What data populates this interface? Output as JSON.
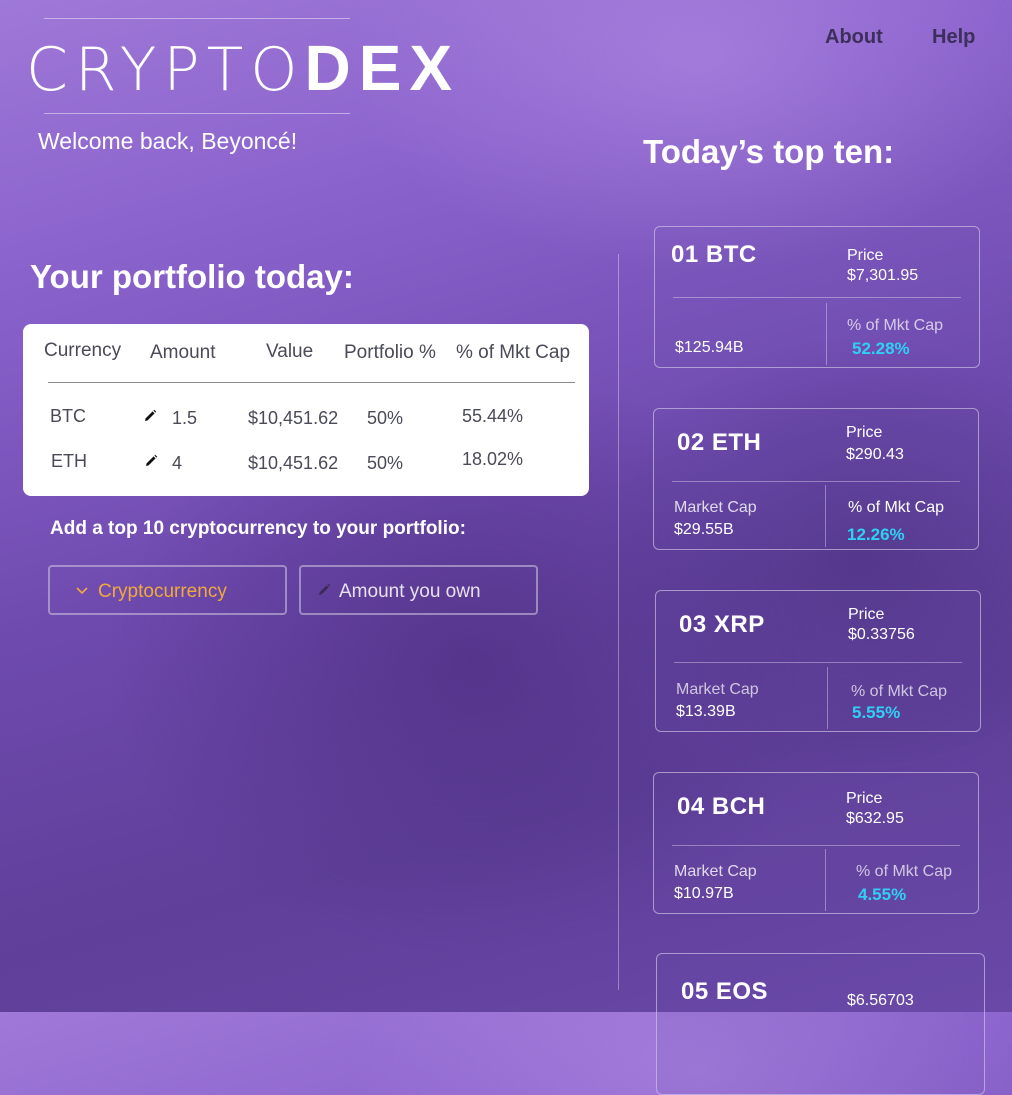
{
  "app": {
    "logo_light": "CRYPTO",
    "logo_bold": "DEX",
    "welcome": "Welcome back, Beyoncé!"
  },
  "nav": {
    "about": "About",
    "help": "Help"
  },
  "portfolio": {
    "heading": "Your portfolio today:",
    "columns": [
      "Currency",
      "Amount",
      "Value",
      "Portfolio %",
      "% of Mkt Cap"
    ],
    "rows": [
      {
        "currency": "BTC",
        "amount": "1.5",
        "value": "$10,451.62",
        "portfolio_pct": "50%",
        "mkt_cap_pct": "55.44%"
      },
      {
        "currency": "ETH",
        "amount": "4",
        "value": "$10,451.62",
        "portfolio_pct": "50%",
        "mkt_cap_pct": "18.02%"
      }
    ]
  },
  "add_form": {
    "label": "Add a top 10 cryptocurrency to your portfolio:",
    "select_placeholder": "Cryptocurrency",
    "amount_placeholder": "Amount you own"
  },
  "top_ten": {
    "heading": "Today’s top ten:",
    "coins": [
      {
        "title": "01 BTC",
        "price_label": "Price",
        "price": "$7,301.95",
        "mc_label": "",
        "market_cap": "$125.94B",
        "pct_label": "% of Mkt Cap",
        "pct": "52.28%"
      },
      {
        "title": "02 ETH",
        "price_label": "Price",
        "price": "$290.43",
        "mc_label": "Market Cap",
        "market_cap": "$29.55B",
        "pct_label": "% of Mkt Cap",
        "pct": "12.26%"
      },
      {
        "title": "03 XRP",
        "price_label": "Price",
        "price": "$0.33756",
        "mc_label": "Market Cap",
        "market_cap": "$13.39B",
        "pct_label": "% of Mkt Cap",
        "pct": "5.55%"
      },
      {
        "title": "04 BCH",
        "price_label": "Price",
        "price": "$632.95",
        "mc_label": "Market Cap",
        "market_cap": "$10.97B",
        "pct_label": "% of Mkt Cap",
        "pct": "4.55%"
      },
      {
        "title": "05 EOS",
        "price_label": "",
        "price": "$6.56703",
        "mc_label": "",
        "market_cap": "",
        "pct_label": "",
        "pct": ""
      }
    ]
  },
  "colors": {
    "accent_cyan": "#2fd0f5",
    "accent_orange": "#f2a93b",
    "nav_text": "#3d2f5c"
  },
  "icons": {
    "edit": "pencil-icon",
    "dropdown": "chevron-down-icon"
  }
}
